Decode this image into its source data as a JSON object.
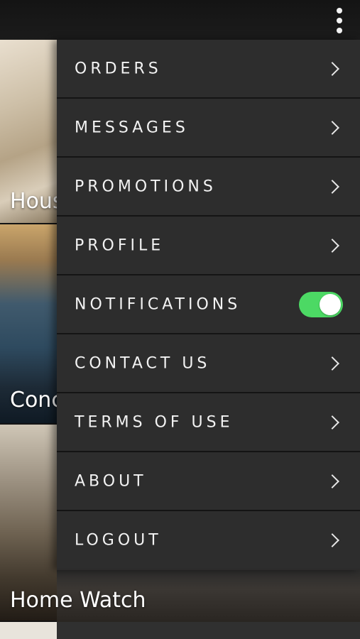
{
  "colors": {
    "toggle_on": "#4cd964",
    "menu_bg": "#2d2d2d"
  },
  "background_items": [
    {
      "label": "Hous"
    },
    {
      "label": "Conc"
    },
    {
      "label": "Home Watch"
    }
  ],
  "menu": {
    "items": [
      {
        "label": "ORDERS",
        "icon": "chevron-right-icon"
      },
      {
        "label": "MESSAGES",
        "icon": "chevron-right-icon"
      },
      {
        "label": "PROMOTIONS",
        "icon": "chevron-right-icon"
      },
      {
        "label": "PROFILE",
        "icon": "chevron-right-icon"
      },
      {
        "label": "NOTIFICATIONS",
        "toggle_on": true
      },
      {
        "label": "CONTACT US",
        "icon": "chevron-right-icon"
      },
      {
        "label": "TERMS OF USE",
        "icon": "chevron-right-icon"
      },
      {
        "label": "ABOUT",
        "icon": "chevron-right-icon"
      },
      {
        "label": "LOGOUT",
        "icon": "chevron-right-icon"
      }
    ]
  },
  "header": {
    "menu_icon": "more-vertical-icon"
  }
}
